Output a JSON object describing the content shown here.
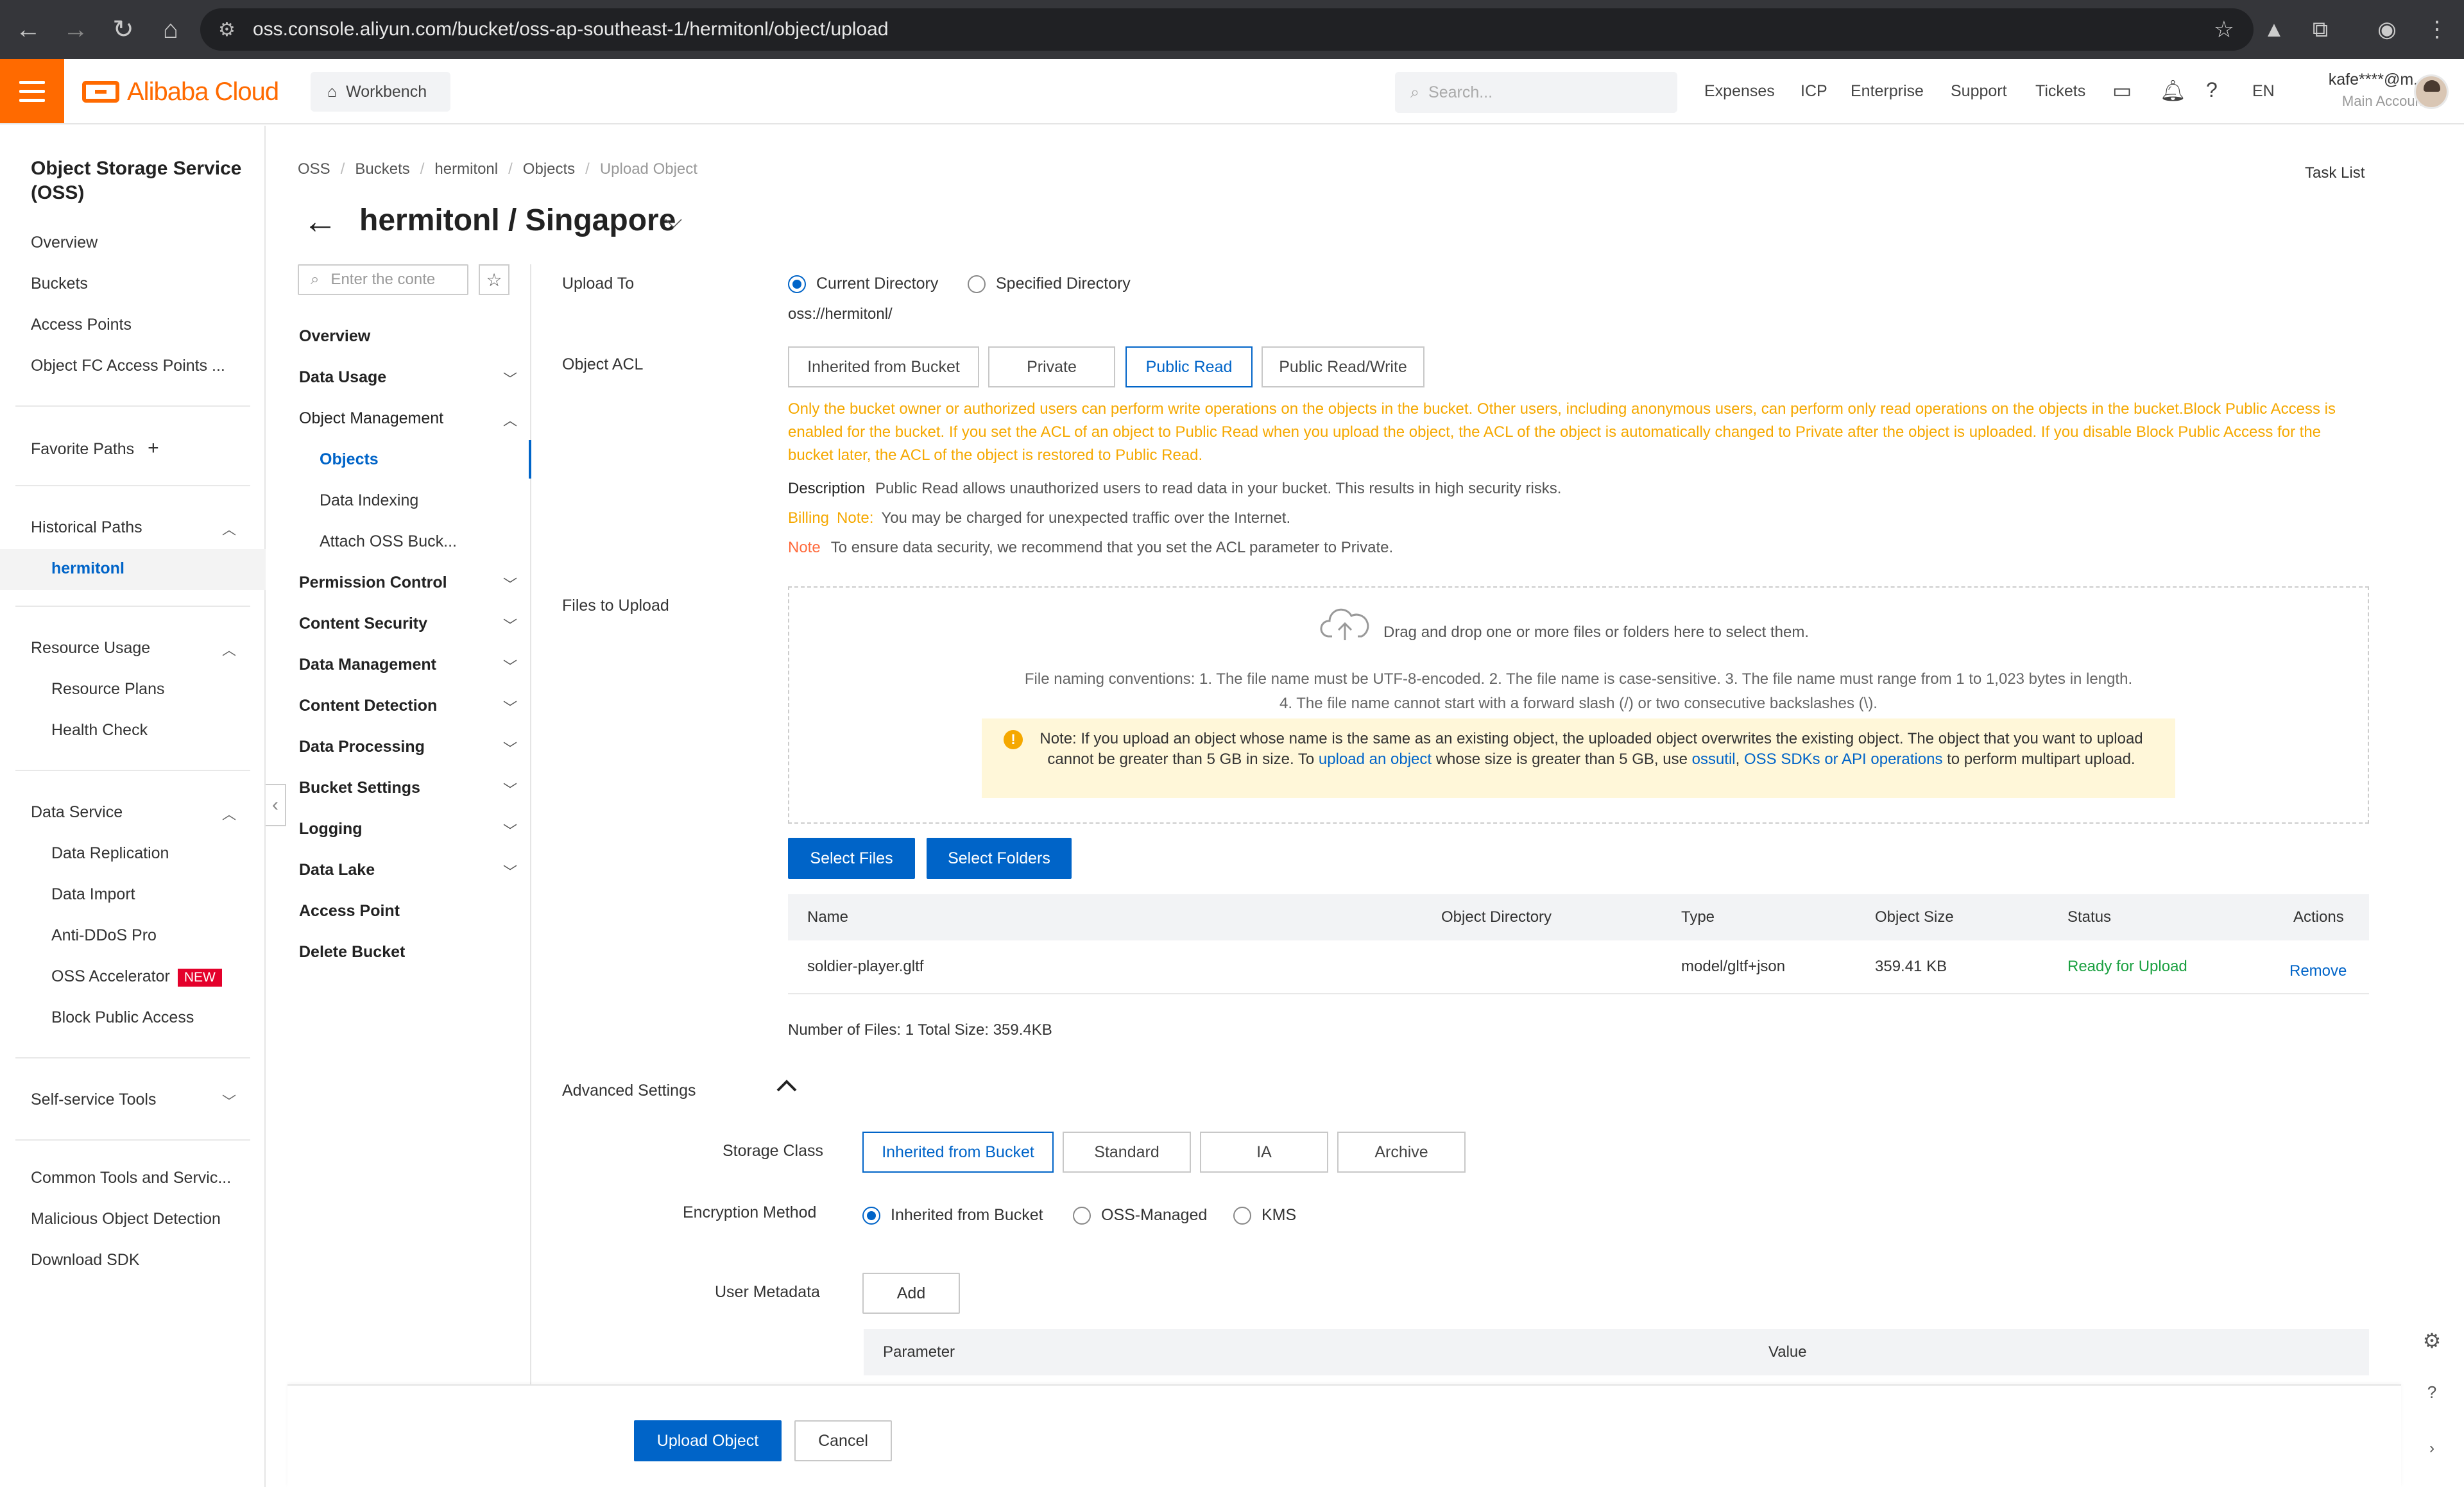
{
  "browser": {
    "url": "oss.console.aliyun.com/bucket/oss-ap-southeast-1/hermitonl/object/upload"
  },
  "topbar": {
    "brand": "Alibaba Cloud",
    "workbench": "Workbench",
    "search_placeholder": "Search...",
    "links": [
      "Expenses",
      "ICP",
      "Enterprise",
      "Support",
      "Tickets"
    ],
    "lang": "EN",
    "account_name": "kafe****@m...",
    "account_role": "Main Account"
  },
  "sidebar": {
    "title": "Object Storage Service (OSS)",
    "top_items": [
      "Overview",
      "Buckets",
      "Access Points",
      "Object FC Access Points ..."
    ],
    "favorite_paths": "Favorite Paths",
    "historical_paths": "Historical Paths",
    "historical_item": "hermitonl",
    "resource_usage": "Resource Usage",
    "resource_items": [
      "Resource Plans",
      "Health Check"
    ],
    "data_service": "Data Service",
    "data_service_items": [
      "Data Replication",
      "Data Import",
      "Anti-DDoS Pro",
      "OSS Accelerator",
      "Block Public Access"
    ],
    "new_badge": "NEW",
    "self_service": "Self-service Tools",
    "bottom_items": [
      "Common Tools and Servic...",
      "Malicious Object Detection",
      "Download SDK"
    ]
  },
  "breadcrumb": [
    "OSS",
    "Buckets",
    "hermitonl",
    "Objects",
    "Upload Object"
  ],
  "task_list": "Task List",
  "page_title": "hermitonl / Singapore",
  "inner_nav": {
    "search_placeholder": "Enter the conte",
    "overview": "Overview",
    "data_usage": "Data Usage",
    "object_management": "Object Management",
    "sub_items": [
      "Objects",
      "Data Indexing",
      "Attach OSS Buck..."
    ],
    "groups": [
      "Permission Control",
      "Content Security",
      "Data Management",
      "Content Detection",
      "Data Processing",
      "Bucket Settings",
      "Logging",
      "Data Lake"
    ],
    "access_point": "Access Point",
    "delete_bucket": "Delete Bucket"
  },
  "form": {
    "upload_to_label": "Upload To",
    "upload_to_options": [
      "Current Directory",
      "Specified Directory"
    ],
    "upload_to_selected": "Current Directory",
    "upload_path": "oss://hermitonl/",
    "acl_label": "Object ACL",
    "acl_options": [
      "Inherited from Bucket",
      "Private",
      "Public Read",
      "Public Read/Write"
    ],
    "acl_selected": "Public Read",
    "acl_warning": "Only the bucket owner or authorized users can perform write operations on the objects in the bucket. Other users, including anonymous users, can perform only read operations on the objects in the bucket.Block Public Access is enabled for the bucket. If you set the ACL of an object to Public Read when you upload the object, the ACL of the object is automatically changed to Private after the object is uploaded. If you disable Block Public Access for the bucket later, the ACL of the object is restored to Public Read.",
    "description_label": "Description",
    "description_text": "Public Read allows unauthorized users to read data in your bucket. This results in high security risks.",
    "billing_label": "Billing",
    "billing_note_label": "Note:",
    "billing_text": "You may be charged for unexpected traffic over the Internet.",
    "note_label": "Note",
    "note_text": "To ensure data security, we recommend that you set the ACL parameter to Private.",
    "files_label": "Files to Upload",
    "dropzone_text": "Drag and drop one or more files or folders here to select them.",
    "rules_line1": "File naming conventions: 1. The file name must be UTF-8-encoded. 2. The file name is case-sensitive. 3. The file name must range from 1 to 1,023 bytes in length.",
    "rules_line2": "4. The file name cannot start with a forward slash (/) or two consecutive backslashes (\\).",
    "notice_part1": "Note: If you upload an object whose name is the same as an existing object, the uploaded object overwrites the existing object. The object that you want to upload cannot be greater than 5 GB in size. To",
    "notice_link1": "upload an object",
    "notice_part2": "whose size is greater than 5 GB, use",
    "notice_link2": "ossutil",
    "notice_comma": ",",
    "notice_link3": "OSS SDKs or API operations",
    "notice_part3": "to perform multipart upload.",
    "select_files": "Select Files",
    "select_folders": "Select Folders"
  },
  "file_table": {
    "columns": [
      "Name",
      "Object Directory",
      "Type",
      "Object Size",
      "Status",
      "Actions"
    ],
    "rows": [
      {
        "name": "soldier-player.gltf",
        "directory": "",
        "type": "model/gltf+json",
        "size": "359.41 KB",
        "status": "Ready for Upload",
        "action": "Remove"
      }
    ],
    "summary": "Number of Files: 1   Total Size: 359.4KB"
  },
  "advanced": {
    "label": "Advanced Settings",
    "storage_class_label": "Storage Class",
    "storage_class_options": [
      "Inherited from Bucket",
      "Standard",
      "IA",
      "Archive"
    ],
    "storage_class_selected": "Inherited from Bucket",
    "encryption_label": "Encryption Method",
    "encryption_options": [
      "Inherited from Bucket",
      "OSS-Managed",
      "KMS"
    ],
    "encryption_selected": "Inherited from Bucket",
    "metadata_label": "User Metadata",
    "add_button": "Add",
    "metadata_columns": [
      "Parameter",
      "Value"
    ]
  },
  "footer": {
    "upload_button": "Upload Object",
    "cancel_button": "Cancel"
  },
  "colors": {
    "brand": "#ff6a00",
    "primary": "#0064c8",
    "warning": "#f5a800",
    "success": "#1aa040",
    "danger": "#e4002b"
  }
}
